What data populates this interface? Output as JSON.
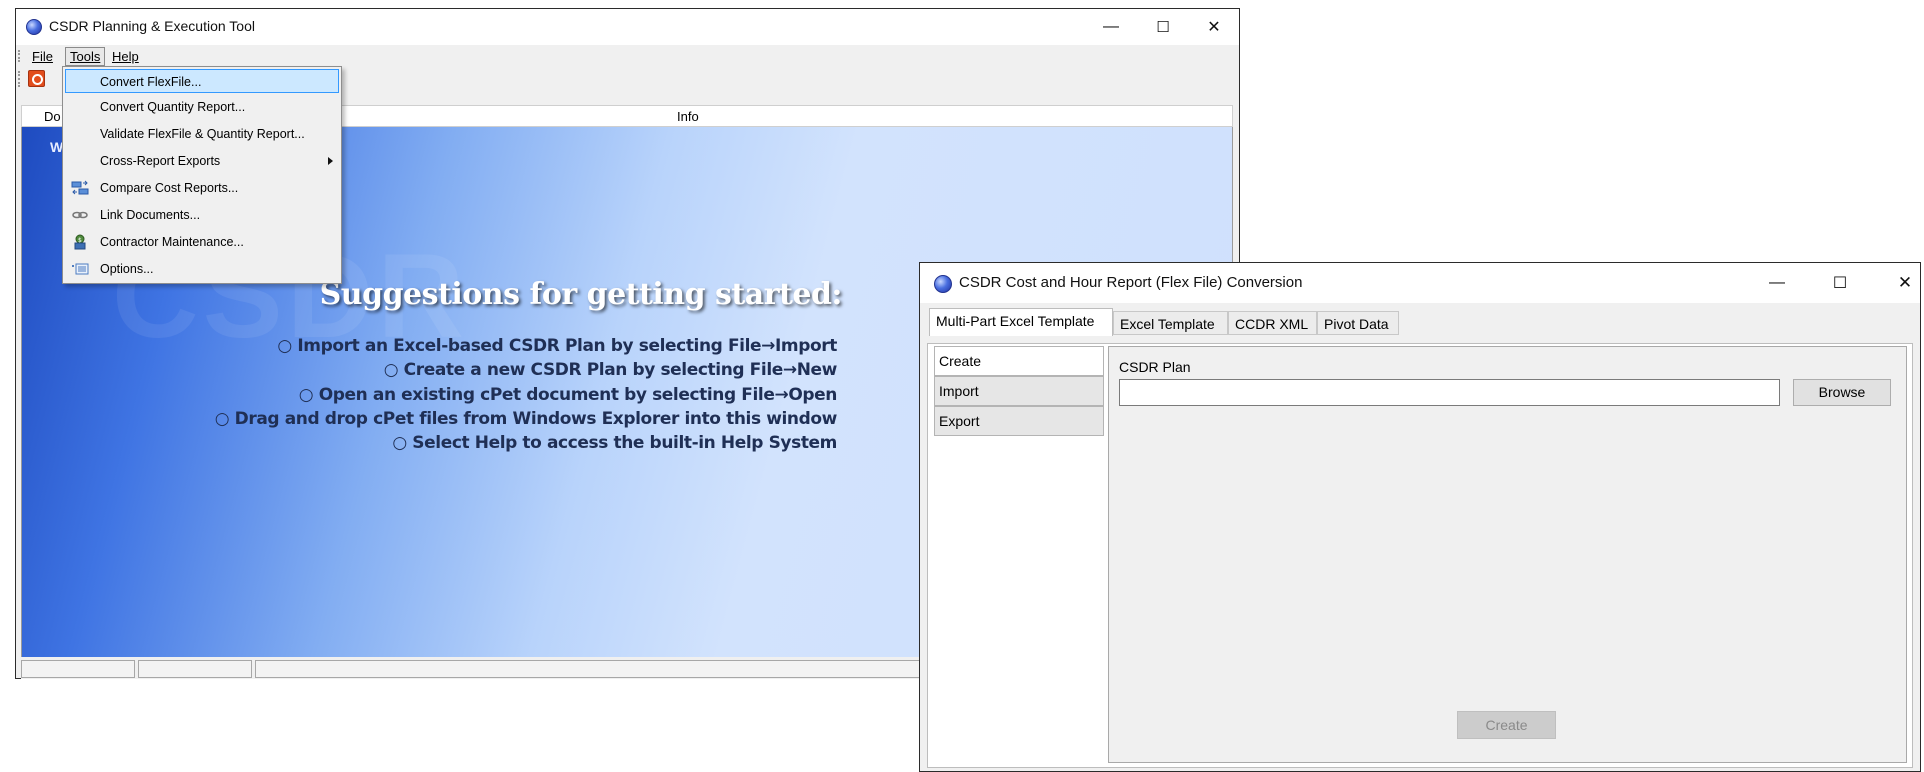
{
  "main_window": {
    "title": "CSDR Planning & Execution Tool",
    "menu": {
      "file": "File",
      "tools": "Tools",
      "help": "Help"
    },
    "list_header": {
      "col1": "Do",
      "col2": "Info"
    },
    "content": {
      "welcome": "W",
      "watermark": "CSDR",
      "suggestions_title": "Suggestions for getting started:",
      "suggestions": [
        "○ Import an Excel-based CSDR Plan by selecting File→Import",
        "○ Create a new CSDR Plan by selecting File→New",
        "○ Open an existing cPet document by selecting File→Open",
        "○ Drag and drop cPet files from Windows Explorer into this window",
        "○ Select Help to access the built-in Help System"
      ]
    }
  },
  "tools_menu": {
    "items": [
      {
        "label": "Convert FlexFile...",
        "icon": "",
        "highlighted": true
      },
      {
        "label": "Convert Quantity Report...",
        "icon": ""
      },
      {
        "label": "Validate FlexFile & Quantity Report...",
        "icon": ""
      },
      {
        "label": "Cross-Report Exports",
        "icon": "",
        "submenu": true
      },
      {
        "label": "Compare Cost Reports...",
        "icon": "compare-icon"
      },
      {
        "label": "Link Documents...",
        "icon": "link-icon"
      },
      {
        "label": "Contractor Maintenance...",
        "icon": "contractor-icon"
      },
      {
        "label": "Options...",
        "icon": "options-icon"
      }
    ]
  },
  "conversion_window": {
    "title": "CSDR Cost and Hour Report (Flex File) Conversion",
    "tabs": [
      "Multi-Part Excel Template",
      "Excel Template",
      "CCDR XML",
      "Pivot Data"
    ],
    "active_tab": "Multi-Part Excel Template",
    "side_buttons": [
      "Create",
      "Import",
      "Export"
    ],
    "selected_side": "Create",
    "csdr_plan_label": "CSDR Plan",
    "csdr_plan_value": "",
    "browse_label": "Browse",
    "create_label": "Create",
    "create_enabled": false
  },
  "window_controls": {
    "minimize": "—",
    "maximize": "☐",
    "close": "✕"
  }
}
